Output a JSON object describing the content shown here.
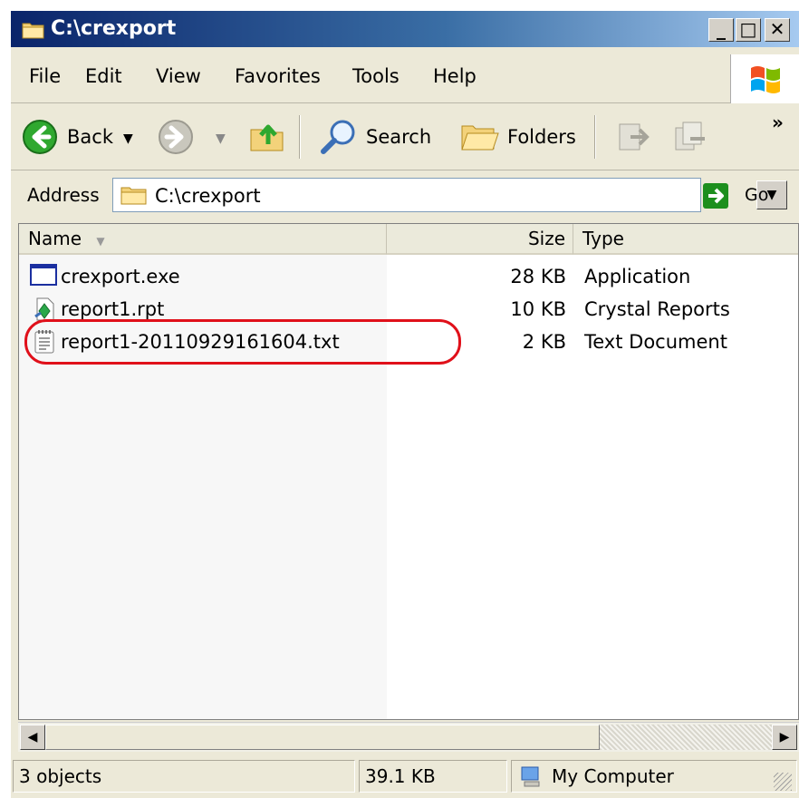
{
  "window": {
    "title": "C:\\crexport"
  },
  "menu": [
    "File",
    "Edit",
    "View",
    "Favorites",
    "Tools",
    "Help"
  ],
  "toolbar": {
    "back": "Back",
    "search": "Search",
    "folders": "Folders",
    "more": "»"
  },
  "address": {
    "label": "Address",
    "value": "C:\\crexport",
    "go": "Go"
  },
  "columns": {
    "name": "Name",
    "size": "Size",
    "type": "Type"
  },
  "files": [
    {
      "name": "crexport.exe",
      "size": "28 KB",
      "type": "Application",
      "icon": "application-icon"
    },
    {
      "name": "report1.rpt",
      "size": "10 KB",
      "type": "Crystal Reports",
      "icon": "crystal-report-icon"
    },
    {
      "name": "report1-20110929161604.txt",
      "size": "2 KB",
      "type": "Text Document",
      "icon": "text-document-icon"
    }
  ],
  "status": {
    "objects": "3 objects",
    "size": "39.1 KB",
    "location": "My Computer"
  },
  "colors": {
    "highlight": "#e0101a",
    "title_start": "#0a246a",
    "title_end": "#a6caf0"
  }
}
